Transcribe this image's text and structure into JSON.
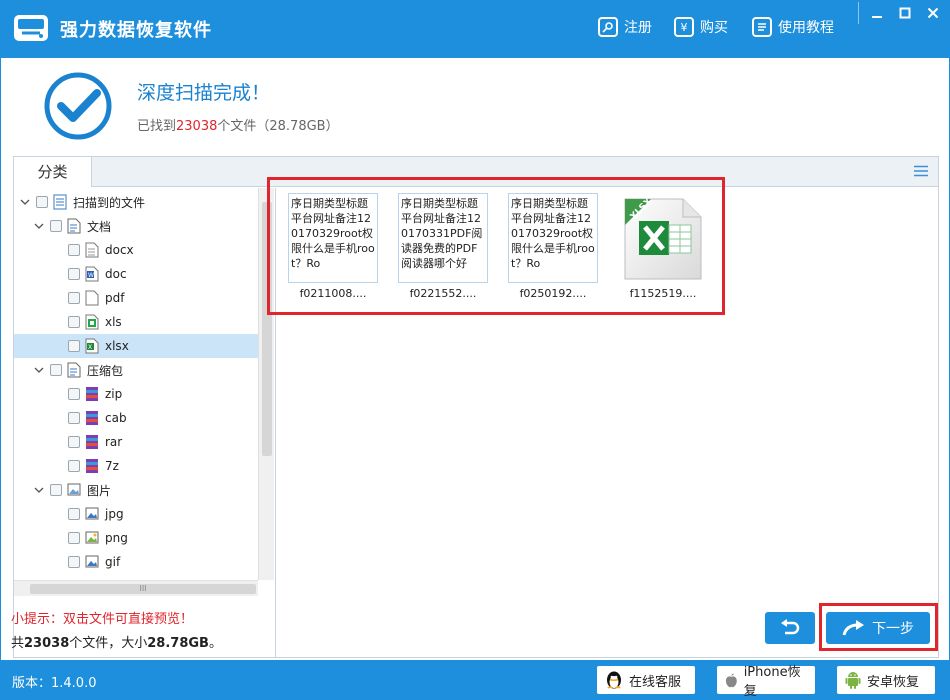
{
  "app": {
    "title": "强力数据恢复软件",
    "register": "注册",
    "buy": "购买",
    "tutorial": "使用教程",
    "buy_icon_glyph": "¥"
  },
  "status": {
    "title": "深度扫描完成！",
    "found_prefix": "已找到",
    "found_count": "23038",
    "found_suffix": "个文件（28.78GB）"
  },
  "panel": {
    "tab": "分类"
  },
  "tree": [
    {
      "label": "扫描到的文件",
      "icon": "list-icon"
    },
    {
      "label": "文档",
      "icon": "document-icon"
    },
    {
      "label": "docx",
      "icon": "docx-icon"
    },
    {
      "label": "doc",
      "icon": "doc-icon"
    },
    {
      "label": "pdf",
      "icon": "pdf-icon"
    },
    {
      "label": "xls",
      "icon": "xls-icon"
    },
    {
      "label": "xlsx",
      "icon": "xlsx-icon"
    },
    {
      "label": "压缩包",
      "icon": "archive-folder-icon"
    },
    {
      "label": "zip",
      "icon": "zip-icon"
    },
    {
      "label": "cab",
      "icon": "cab-icon"
    },
    {
      "label": "rar",
      "icon": "rar-icon"
    },
    {
      "label": "7z",
      "icon": "7z-icon"
    },
    {
      "label": "图片",
      "icon": "image-folder-icon"
    },
    {
      "label": "jpg",
      "icon": "jpg-icon"
    },
    {
      "label": "png",
      "icon": "png-icon"
    },
    {
      "label": "gif",
      "icon": "gif-icon"
    }
  ],
  "scrollbar_grip": "III",
  "files": [
    {
      "preview": "序日期类型标题平台网址备注120170329root权限什么是手机root？Ro",
      "name": "f0211008...."
    },
    {
      "preview": "序日期类型标题平台网址备注120170331PDF阅读器免费的PDF阅读器哪个好",
      "name": "f0221552...."
    },
    {
      "preview": "序日期类型标题平台网址备注120170329root权限什么是手机root？Ro",
      "name": "f0250192...."
    },
    {
      "preview": "",
      "name": "f1152519....",
      "badge": "XLSX"
    }
  ],
  "hint": "小提示：双击文件可直接预览！",
  "summary": {
    "prefix": "共",
    "count": "23038",
    "middle": "个文件，大小",
    "size": "28.78GB",
    "suffix": "。"
  },
  "buttons": {
    "next": "下一步"
  },
  "footer": {
    "version": "版本：1.4.0.0",
    "online_service": "在线客服",
    "iphone_recovery": "iPhone恢复",
    "android_recovery": "安卓恢复"
  },
  "colors": {
    "brand": "#1d8fdc",
    "highlight": "#e0252c",
    "selected_row": "#cce4f7"
  }
}
